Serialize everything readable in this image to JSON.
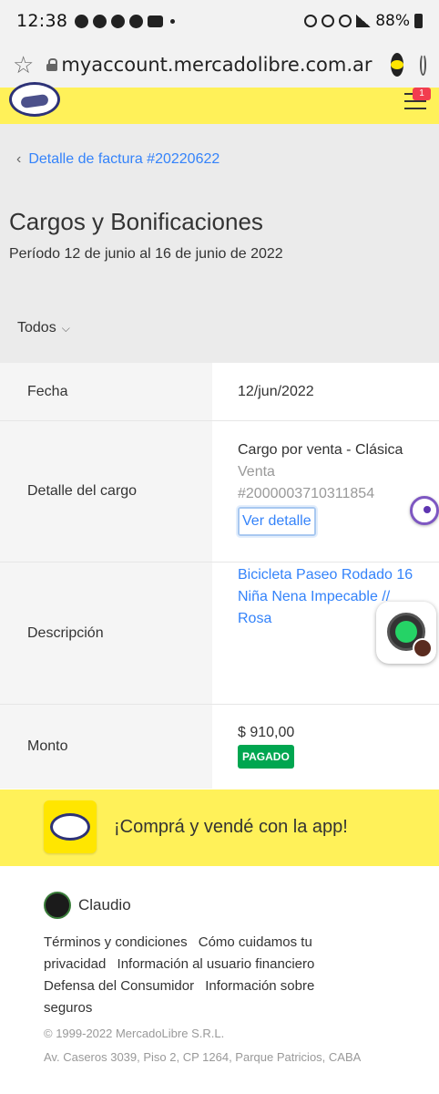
{
  "status_bar": {
    "time": "12:38",
    "battery": "88%"
  },
  "browser": {
    "url": "myaccount.mercadolibre.com.ar"
  },
  "header": {
    "notification_count": "1"
  },
  "nav": {
    "back_label": "Detalle de factura #20220622"
  },
  "page": {
    "title": "Cargos y Bonificaciones",
    "period": "Período 12 de junio al 16 de junio de 2022",
    "filter_label": "Todos"
  },
  "table": {
    "fecha_label": "Fecha",
    "fecha_value": "12/jun/2022",
    "detalle_label": "Detalle del cargo",
    "detalle_line1": "Cargo por venta - Clásica",
    "detalle_line2": "Venta",
    "detalle_line3": "#2000003710311854",
    "detalle_link": "Ver detalle",
    "descripcion_label": "Descripción",
    "descripcion_value": "Bicicleta Paseo Rodado 16 Niña Nena Impecable // Rosa",
    "monto_label": "Monto",
    "monto_value": "$ 910,00",
    "status_badge": "PAGADO"
  },
  "app_banner": {
    "text": "¡Comprá y vendé con la app!"
  },
  "footer": {
    "user_name": "Claudio",
    "links": [
      "Términos y condiciones",
      "Cómo cuidamos tu privacidad",
      "Información al usuario financiero",
      "Defensa del Consumidor",
      "Información sobre seguros"
    ],
    "copyright": "© 1999-2022 MercadoLibre S.R.L.",
    "address": "Av. Caseros 3039, Piso 2, CP 1264, Parque Patricios, CABA"
  },
  "colors": {
    "brand_yellow": "#fff159",
    "link_blue": "#3483fa",
    "paid_green": "#00a650"
  }
}
